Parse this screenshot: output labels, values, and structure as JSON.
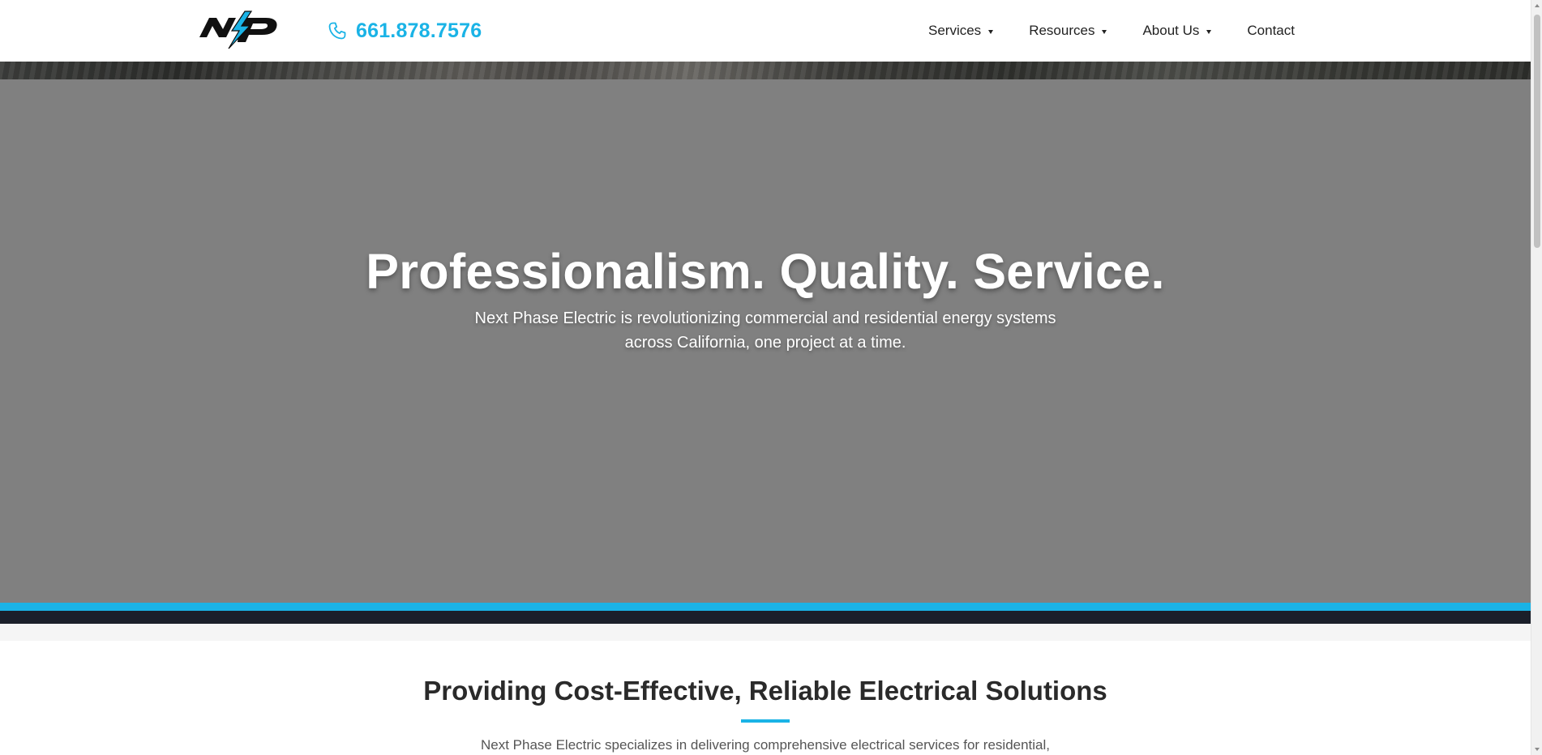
{
  "header": {
    "logo_alt": "NP",
    "phone": "661.878.7576",
    "nav": [
      {
        "label": "Services",
        "has_dropdown": true
      },
      {
        "label": "Resources",
        "has_dropdown": true
      },
      {
        "label": "About Us",
        "has_dropdown": true
      },
      {
        "label": "Contact",
        "has_dropdown": false
      }
    ]
  },
  "hero": {
    "title": "Professionalism. Quality. Service.",
    "subtitle": "Next Phase Electric is revolutionizing commercial and residential energy systems across California, one project at a time."
  },
  "intro": {
    "title": "Providing Cost-Effective, Reliable Electrical Solutions",
    "text": "Next Phase Electric specializes in delivering comprehensive electrical services for residential,"
  },
  "colors": {
    "accent": "#1ab3e6",
    "hero_overlay": "#808080",
    "dark_band": "#1b1f2a",
    "text_dark": "#2a2a2a"
  },
  "icons": {
    "logo": "np-lightning-logo",
    "phone": "phone-icon",
    "dropdown": "caret-down-icon"
  }
}
